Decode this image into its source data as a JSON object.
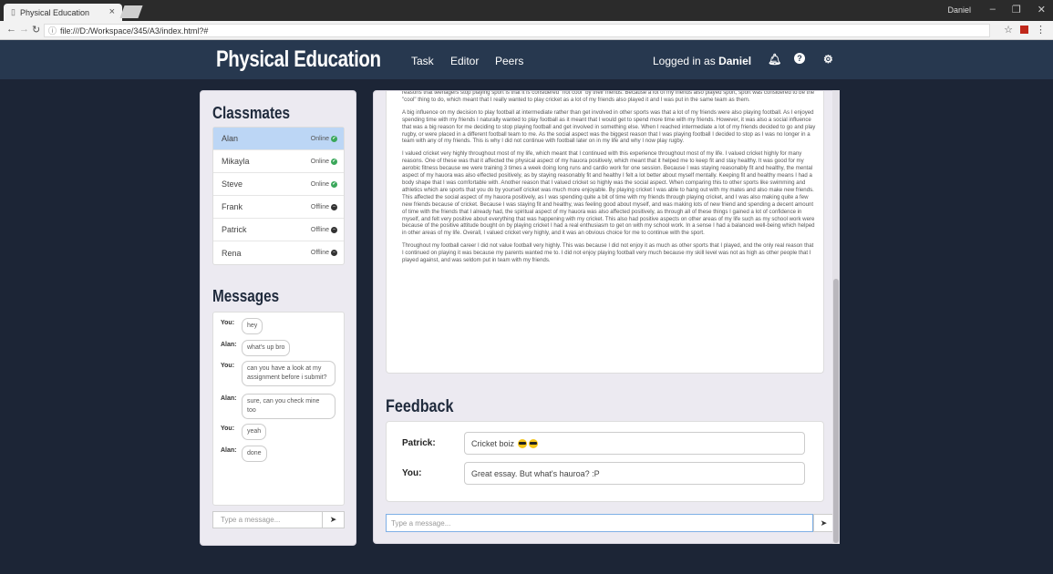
{
  "browser": {
    "tab_title": "Physical Education",
    "url": "file:///D:/Workspace/345/A3/index.html?#",
    "user": "Daniel"
  },
  "navbar": {
    "brand": "Physical Education",
    "links": [
      "Task",
      "Editor",
      "Peers"
    ],
    "logged_in_prefix": "Logged in as",
    "user_name": "Daniel"
  },
  "classmates": {
    "title": "Classmates",
    "items": [
      {
        "name": "Alan",
        "status": "Online"
      },
      {
        "name": "Mikayla",
        "status": "Online"
      },
      {
        "name": "Steve",
        "status": "Online"
      },
      {
        "name": "Frank",
        "status": "Offline"
      },
      {
        "name": "Patrick",
        "status": "Offline"
      },
      {
        "name": "Rena",
        "status": "Offline"
      }
    ]
  },
  "messages": {
    "title": "Messages",
    "items": [
      {
        "who": "You:",
        "text": "hey"
      },
      {
        "who": "Alan:",
        "text": "what's up bro"
      },
      {
        "who": "You:",
        "text": "can you have a look at my assignment before i submit?"
      },
      {
        "who": "Alan:",
        "text": "sure, can you check mine too"
      },
      {
        "who": "You:",
        "text": "yeah"
      },
      {
        "who": "Alan:",
        "text": "done"
      }
    ],
    "placeholder": "Type a message..."
  },
  "essay": {
    "paragraphs": [
      "reasons that teenagers stop playing sport is that it is considered \"not cool\" by their friends. Because a lot of my friends also played sport, sport was considered to be the \"cool\" thing to do, which meant that I really wanted to play cricket as a lot of my friends also played it and I was put in the same team as them.",
      "A big influence on my decision to play football at intermediate rather than get involved in other sports was that a lot of my friends were also playing football. As I enjoyed spending time with my friends I naturally wanted to play football as it meant that I would get to spend more time with my friends. However, it was also a social influence that was a big reason for me deciding to stop playing football and get involved in something else. When I reached intermediate a lot of my friends decided to go and play rugby, or were placed in a different football team to me. As the social aspect was the biggest reason that I was playing football I decided to stop as I was no longer in a team with any of my friends. This is why I did not continue with football later on in my life and why I now play rugby.",
      "I valued cricket very highly throughout most of my life, which meant that I continued with this experience throughout most of my life. I valued cricket highly for many reasons. One of these was that it affected the physical aspect of my hauora positively, which meant that it helped me to keep fit and stay healthy. It was good for my aerobic fitness because we were training 3 times a week doing long runs and cardio work for one session. Because I was staying reasonably fit and healthy, the mental aspect of my hauora was also effected positively, as by staying reasonably fit and healthy I felt a lot better about myself mentally. Keeping fit and healthy means I had a body shape that I was comfortable with. Another reason that I valued cricket so highly was the social aspect. When comparing this to other sports like swimming and athletics which are sports that you do by yourself cricket was much more enjoyable. By playing cricket I was able to hang out with my mates and also make new friends. This affected the social aspect of my hauora positively, as I was spending quite a bit of time with my friends through playing cricket, and I was also making quite a few new friends because of cricket. Because I was staying fit and healthy, was feeling good about myself, and was making lots of new friend and spending a decent amount of time with the friends that I already had, the spiritual aspect of my hauora was also affected positively, as through all of these things I gained a lot of confidence in myself, and felt very positive about everything that was happening with my cricket. This also had positive aspects on other areas of my life such as my school work were because of the positive attitude bought on by playing cricket I had a real enthusiasm to get on with my school work. In a sense I had a balanced well-being which helped in other areas of my life. Overall, I valued cricket very highly, and it was an obvious choice for me to continue with the sport.",
      "Throughout my football career I did not value football very highly. This was because I did not enjoy it as much as other sports that I played, and the only real reason that I continued on playing it was because my parents wanted me to. I did not enjoy playing football very much because my skill level was not as high as other people that I played against, and was seldom put in team with my friends."
    ]
  },
  "feedback": {
    "title": "Feedback",
    "items": [
      {
        "who": "Patrick:",
        "text": "Cricket boiz",
        "emoji_count": 2
      },
      {
        "who": "You:",
        "text": "Great essay. But what's hauroa? :P"
      }
    ],
    "placeholder": "Type a message..."
  },
  "icons": {
    "bell": "bell-icon",
    "help": "help-icon",
    "settings": "gear-icon",
    "send": "send-icon"
  }
}
